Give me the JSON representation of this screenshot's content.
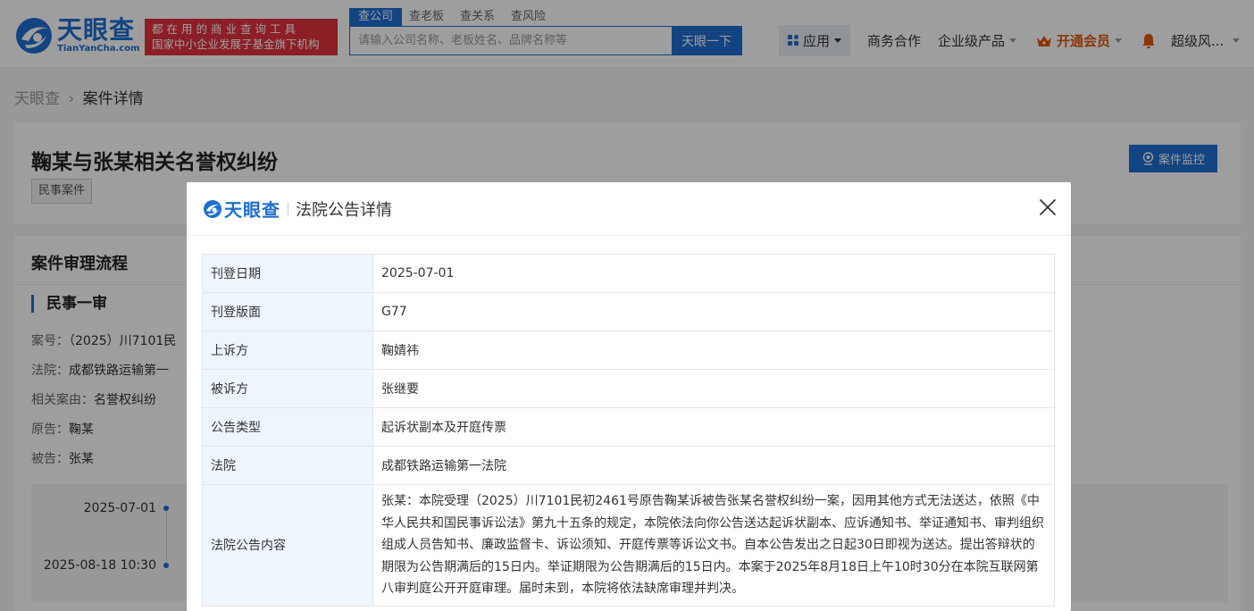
{
  "header": {
    "logo_cn": "天眼查",
    "logo_en": "TianYanCha.com",
    "slogan_line1": "都在用的商业查询工具",
    "slogan_line2": "国家中小企业发展子基金旗下机构",
    "tabs": [
      "查公司",
      "查老板",
      "查关系",
      "查风险"
    ],
    "search_placeholder": "请输入公司名称、老板姓名、品牌名称等",
    "search_button": "天眼一下",
    "nav": {
      "app": "应用",
      "business": "商务合作",
      "enterprise": "企业级产品",
      "vip": "开通会员",
      "user": "超级风..."
    }
  },
  "breadcrumb": {
    "home": "天眼查",
    "separator": "›",
    "current": "案件详情"
  },
  "case": {
    "title": "鞠某与张某相关名誉权纠纷",
    "tag": "民事案件",
    "monitor_button": "案件监控"
  },
  "process": {
    "section_title": "案件审理流程",
    "stage": "民事一审",
    "case_no_label": "案号：",
    "case_no": "（2025）川7101民",
    "court_label": "法院：",
    "court": "成都铁路运输第一",
    "cause_label": "相关案由：",
    "cause": "名誉权纠纷",
    "plaintiff_label": "原告：",
    "plaintiff": "鞠某",
    "defendant_label": "被告：",
    "defendant": "张某",
    "timeline": [
      "2025-07-01",
      "2025-08-18 10:30"
    ]
  },
  "modal": {
    "logo": "天眼查",
    "title": "法院公告详情",
    "rows": [
      {
        "label": "刊登日期",
        "value": "2025-07-01"
      },
      {
        "label": "刊登版面",
        "value": "G77"
      },
      {
        "label": "上诉方",
        "value": "鞠婧祎"
      },
      {
        "label": "被诉方",
        "value": "张继要"
      },
      {
        "label": "公告类型",
        "value": "起诉状副本及开庭传票"
      },
      {
        "label": "法院",
        "value": "成都铁路运输第一法院"
      },
      {
        "label": "法院公告内容",
        "value": "张某：本院受理（2025）川7101民初2461号原告鞠某诉被告张某名誉权纠纷一案，因用其他方式无法送达，依照《中华人民共和国民事诉讼法》第九十五条的规定，本院依法向你公告送达起诉状副本、应诉通知书、举证通知书、审判组织组成人员告知书、廉政监督卡、诉讼须知、开庭传票等诉讼文书。自本公告发出之日起30日即视为送达。提出答辩状的期限为公告期满后的15日内。举证期限为公告期满后的15日内。本案于2025年8月18日上午10时30分在本院互联网第八审判庭公开开庭审理。届时未到，本院将依法缺席审理并判决。"
      }
    ]
  },
  "colors": {
    "brand": "#1f6fd1",
    "slogan_bg": "#e2313d",
    "vip": "#e0580b"
  }
}
